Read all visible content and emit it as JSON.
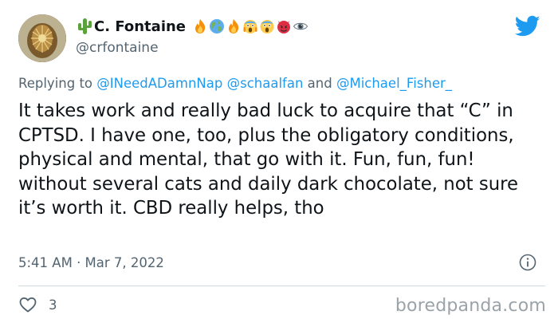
{
  "tweet": {
    "display_name": "C. Fontaine",
    "handle": "@crfontaine",
    "name_icons": [
      "cactus-icon"
    ],
    "emoji_icons": [
      "fire-icon",
      "globe-icon",
      "fire-icon",
      "scream-icon",
      "scream-icon",
      "devil-face-icon",
      "eye-icon"
    ],
    "replying_prefix": "Replying to",
    "mentions": [
      "@INeedADamnNap",
      "@schaalfan",
      "@Michael_Fisher_"
    ],
    "mentions_joiner": "and",
    "text": "It takes work and really bad luck to acquire that “C” in CPTSD.  I have one, too, plus the obligatory conditions, physical and mental, that go with it. Fun, fun, fun! without several cats and daily dark chocolate, not sure it’s worth it. CBD really helps, tho",
    "timestamp": "5:41 AM · Mar 7, 2022",
    "like_count": "3"
  },
  "watermark": "boredpanda.com",
  "colors": {
    "text": "#0f1419",
    "secondary": "#536471",
    "link": "#1d9bf0",
    "twitter_blue": "#1d9bf0",
    "divider": "#cfd9de"
  }
}
